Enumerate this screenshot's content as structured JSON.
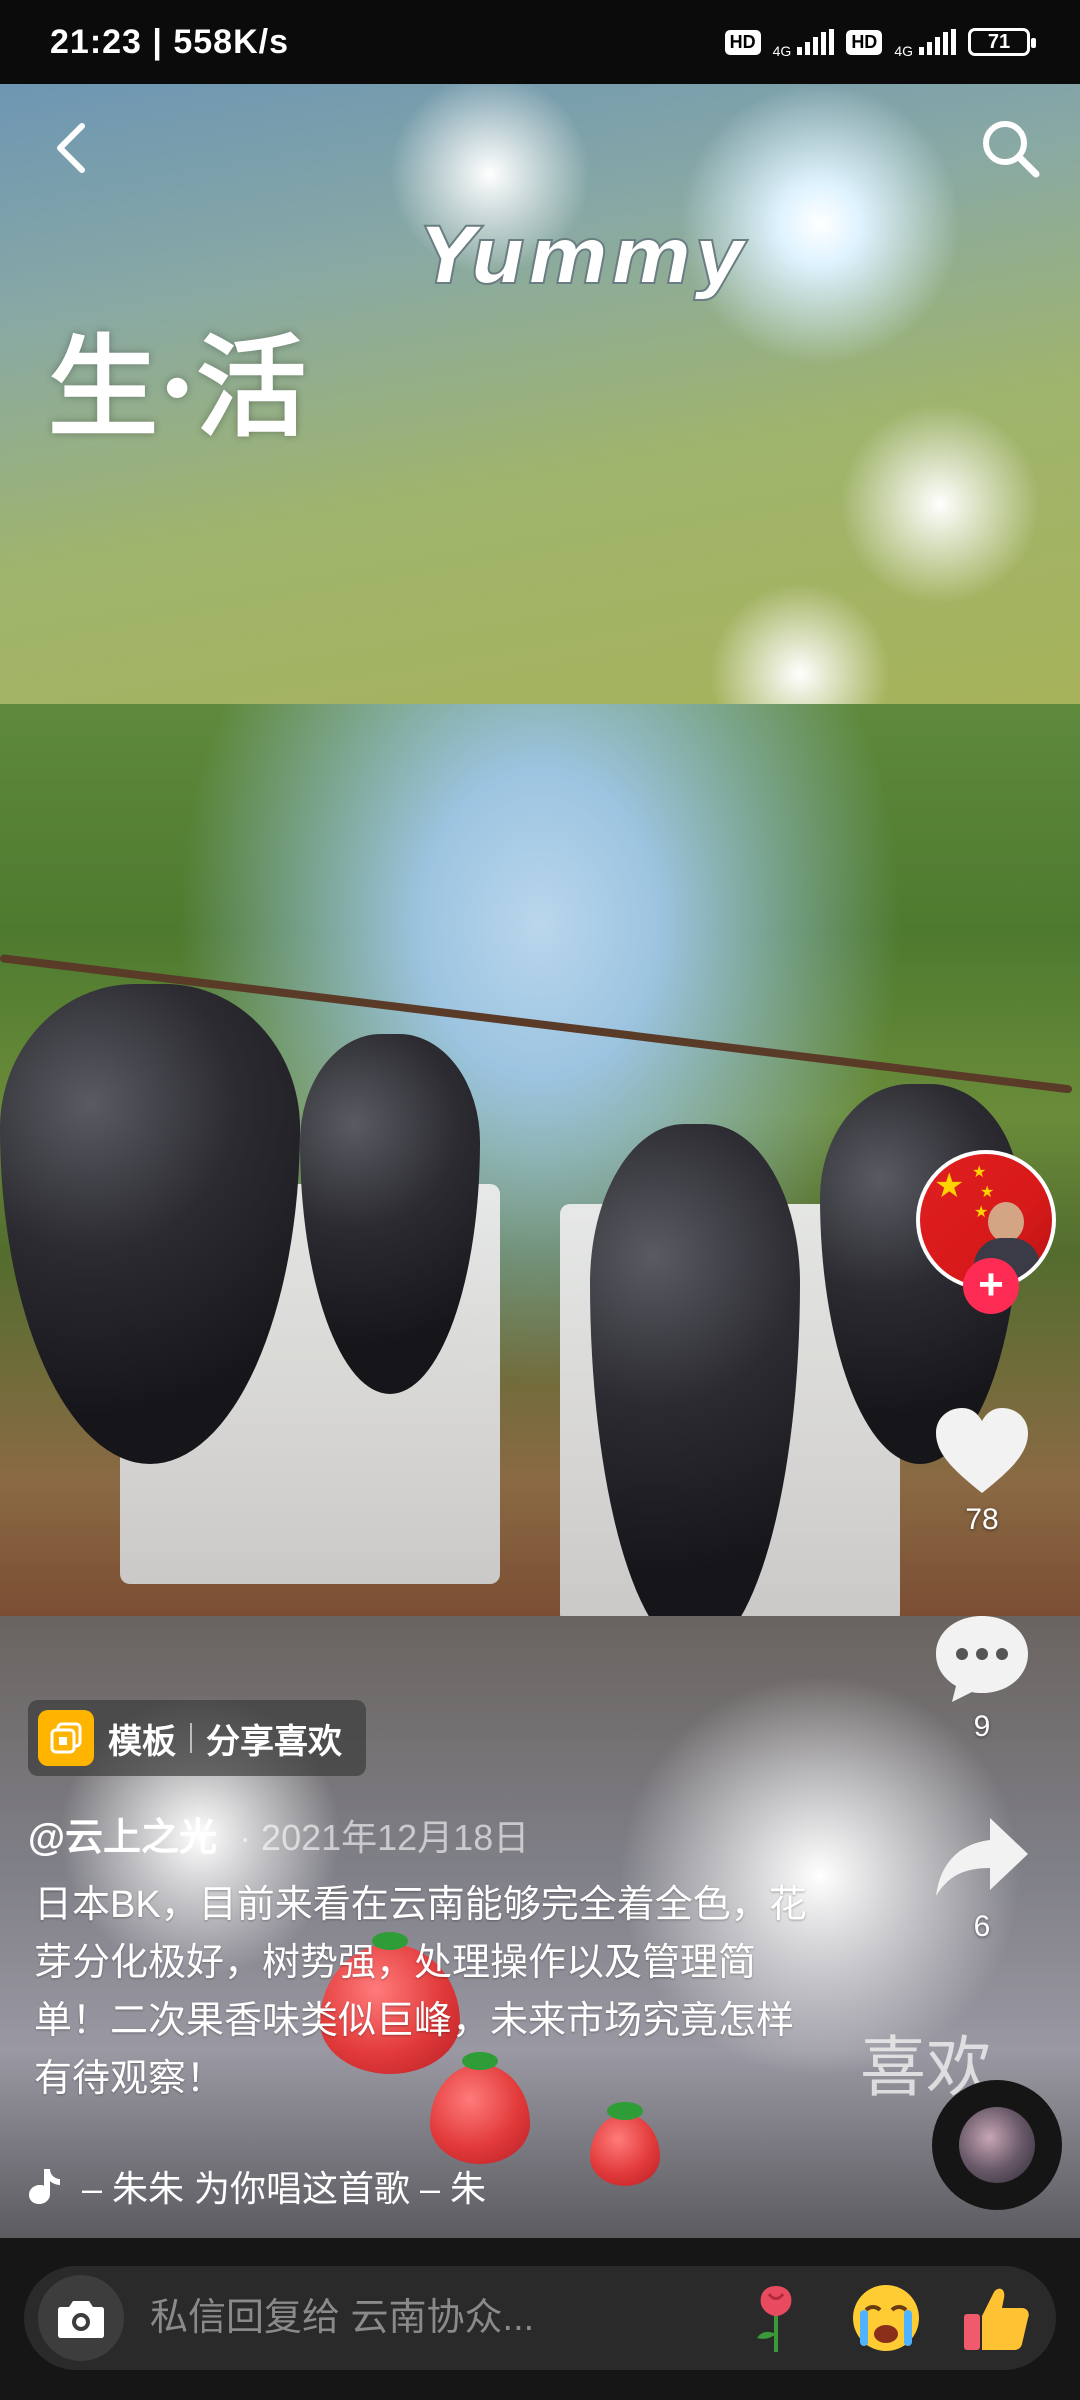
{
  "status_bar": {
    "time_speed": "21:23 | 558K/s",
    "hd1": "HD",
    "net1": "4G",
    "hd2": "HD",
    "net2": "4G",
    "battery": "71"
  },
  "video_overlay": {
    "deco_life": "生·活",
    "deco_yummy": "Yummy",
    "deco_xihuan": "喜欢"
  },
  "rail": {
    "like_count": "78",
    "comment_count": "9",
    "share_count": "6"
  },
  "post": {
    "template_label": "模板",
    "template_text": "分享喜欢",
    "author": "@云上之光",
    "date": "· 2021年12月18日",
    "description": "日本BK，目前来看在云南能够完全着全色，花芽分化极好，树势强，处理操作以及管理简单！二次果香味类似巨峰，未来市场究竟怎样有待观察！",
    "music": "– 朱朱    为你唱这首歌 – 朱"
  },
  "reply_bar": {
    "placeholder": "私信回复给 云南协众..."
  },
  "colors": {
    "accent": "#fe2c55",
    "chip_icon": "#ffb400",
    "bottom_bar": "#161616"
  }
}
